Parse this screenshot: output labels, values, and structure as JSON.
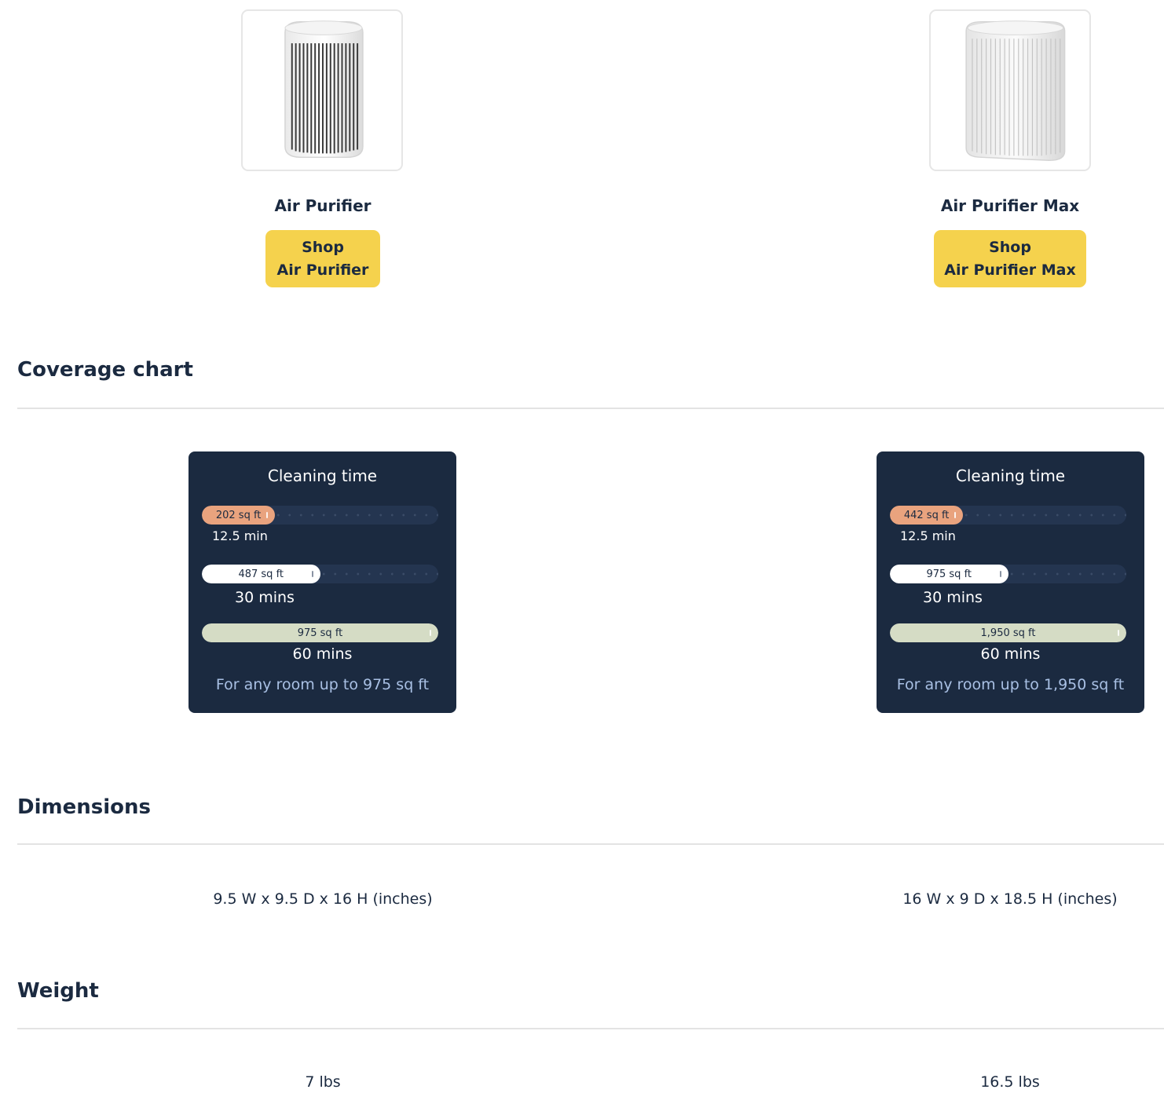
{
  "products": [
    {
      "name": "Air Purifier",
      "shop_line1": "Shop",
      "shop_line2": "Air Purifier",
      "image_icon": "air-purifier-image",
      "coverage": {
        "title": "Cleaning time",
        "bars": [
          {
            "area": "202 sq ft",
            "time": "12.5 min",
            "fill_fraction": 0.31,
            "color": "#e9a37e"
          },
          {
            "area": "487 sq ft",
            "time": "30 mins",
            "fill_fraction": 0.5,
            "color": "#ffffff"
          },
          {
            "area": "975 sq ft",
            "time": "60 mins",
            "fill_fraction": 1.0,
            "color": "#d5dcc5"
          }
        ],
        "footer": "For any room up to 975 sq ft"
      },
      "dimensions": "9.5 W x 9.5 D x 16 H (inches)",
      "weight": "7 lbs"
    },
    {
      "name": "Air Purifier Max",
      "shop_line1": "Shop",
      "shop_line2": "Air Purifier Max",
      "image_icon": "air-purifier-max-image",
      "coverage": {
        "title": "Cleaning time",
        "bars": [
          {
            "area": "442 sq ft",
            "time": "12.5 min",
            "fill_fraction": 0.31,
            "color": "#e9a37e"
          },
          {
            "area": "975 sq ft",
            "time": "30 mins",
            "fill_fraction": 0.5,
            "color": "#ffffff"
          },
          {
            "area": "1,950 sq ft",
            "time": "60 mins",
            "fill_fraction": 1.0,
            "color": "#d5dcc5"
          }
        ],
        "footer": "For any room up to 1,950 sq ft"
      },
      "dimensions": "16 W x 9 D x 18.5 H (inches)",
      "weight": "16.5 lbs"
    }
  ],
  "sections": {
    "coverage": "Coverage chart",
    "dimensions": "Dimensions",
    "weight": "Weight"
  },
  "colors": {
    "accent": "#f5d24d",
    "heading": "#1b2a40",
    "card_bg": "#1b2a40",
    "card_footer": "#a9c0e4"
  }
}
